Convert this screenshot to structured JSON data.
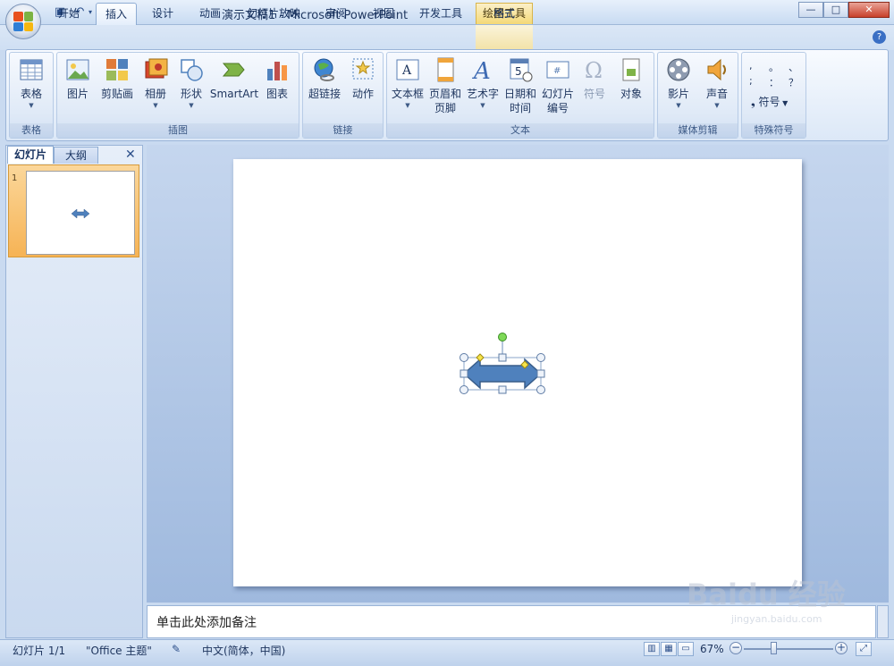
{
  "app": {
    "doc_title": "演示文稿1 - Microsoft PowerPoint",
    "contextual_tool": "绘图工具"
  },
  "window_buttons": {
    "minimize": "—",
    "maximize": "□",
    "close": "✕"
  },
  "tabs": [
    {
      "label": "开始"
    },
    {
      "label": "插入"
    },
    {
      "label": "设计"
    },
    {
      "label": "动画"
    },
    {
      "label": "幻灯片放映"
    },
    {
      "label": "审阅"
    },
    {
      "label": "视图"
    },
    {
      "label": "开发工具"
    },
    {
      "label": "格式"
    }
  ],
  "active_tab": "插入",
  "ribbon": {
    "groups": [
      {
        "label": "表格"
      },
      {
        "label": "插图"
      },
      {
        "label": "链接"
      },
      {
        "label": "文本"
      },
      {
        "label": "媒体剪辑"
      },
      {
        "label": "特殊符号"
      }
    ],
    "buttons": {
      "table": "表格",
      "picture": "图片",
      "clipart": "剪贴画",
      "album": "相册",
      "shapes": "形状",
      "smartart": "SmartArt",
      "chart": "图表",
      "hyperlink": "超链接",
      "action": "动作",
      "textbox": "文本框",
      "header_footer_1": "页眉和",
      "header_footer_2": "页脚",
      "wordart": "艺术字",
      "datetime_1": "日期和",
      "datetime_2": "时间",
      "slide_number_1": "幻灯片",
      "slide_number_2": "编号",
      "symbol": "符号",
      "object": "对象",
      "movie": "影片",
      "sound": "声音",
      "special_symbol": "符号"
    },
    "special_symbols": [
      ",",
      "。",
      "、",
      ";",
      "：",
      "？"
    ]
  },
  "left_panel": {
    "tab_slides": "幻灯片",
    "tab_outline": "大纲",
    "close": "✕",
    "slide_number": "1"
  },
  "notes": {
    "placeholder": "单击此处添加备注"
  },
  "status": {
    "slide": "幻灯片 1/1",
    "theme": "\"Office 主题\"",
    "language": "中文(简体，中国)",
    "zoom": "67%"
  },
  "watermark": {
    "text": "Baidu 经验",
    "url": "jingyan.baidu.com"
  },
  "colors": {
    "accent": "#4f81bd",
    "shape_fill": "#4f81bd",
    "shape_border": "#385d8a",
    "selected_thumb": "#f6b355"
  }
}
